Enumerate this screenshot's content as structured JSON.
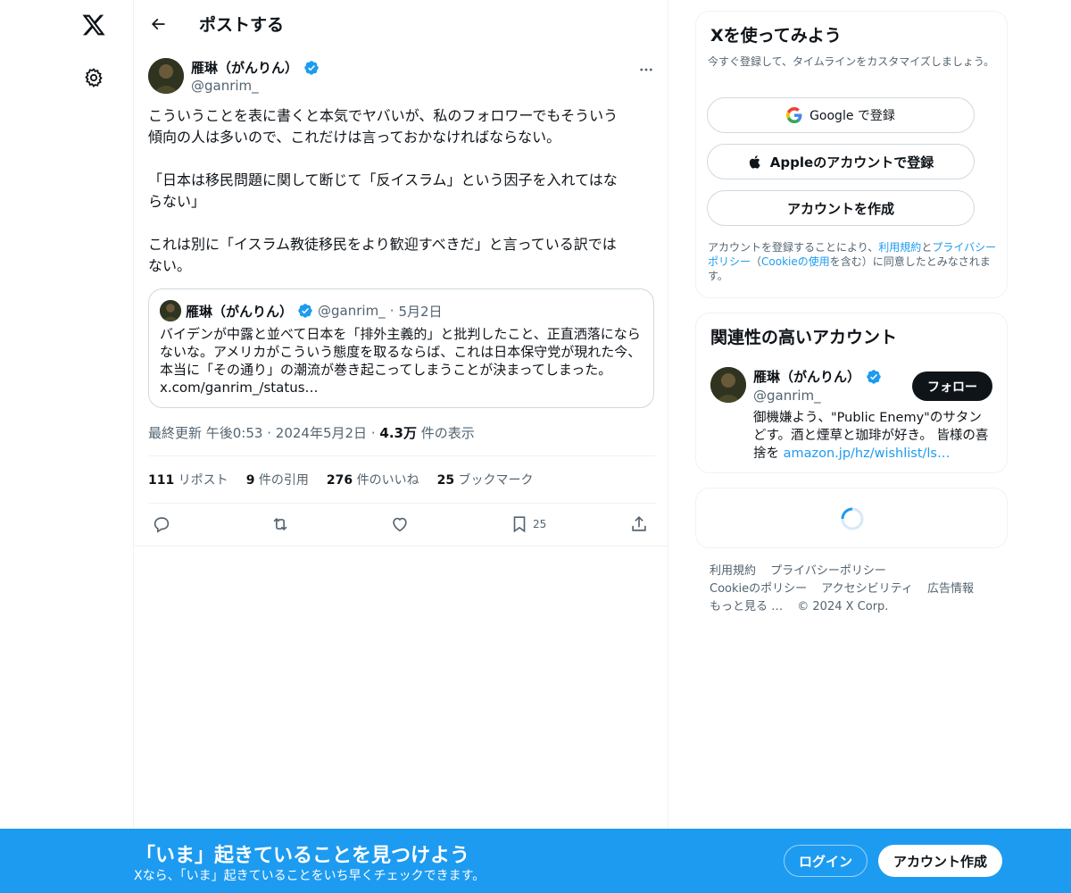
{
  "header": {
    "title": "ポストする"
  },
  "post": {
    "author_name": "雁琳（がんりん）",
    "author_handle": "@ganrim_",
    "text": "こういうことを表に書くと本気でヤバいが、私のフォロワーでもそういう\n傾向の人は多いので、これだけは言っておかなければならない。\n\n「日本は移民問題に関して断じて「反イスラム」という因子を入れてはな\nらない」\n\nこれは別に「イスラム教徒移民をより歓迎すべきだ」と言っている訳では\nない。",
    "quote": {
      "author_name": "雁琳（がんりん）",
      "author_handle": "@ganrim_",
      "date": "5月2日",
      "separator": "·",
      "text": "バイデンが中露と並べて日本を「排外主義的」と批判したこと、正直洒落になら\nないな。アメリカがこういう態度を取るならば、これは日本保守党が現れた今、\n本当に「その通り」の潮流が巻き起こってしまうことが決まってしまった。\nx.com/ganrim_/status…"
    },
    "meta": {
      "updated": "最終更新 午後0:53",
      "date": "2024年5月2日",
      "separator": "·",
      "views_count": "4.3万",
      "views_label": "件の表示"
    },
    "stats": {
      "reposts_count": "111",
      "reposts_label": "リポスト",
      "quotes_count": "9",
      "quotes_label": "件の引用",
      "likes_count": "276",
      "likes_label": "件のいいね",
      "bookmarks_count": "25",
      "bookmarks_label": "ブックマーク"
    },
    "actions": {
      "bookmark_count": "25"
    }
  },
  "signup_card": {
    "title": "Xを使ってみよう",
    "subtitle": "今すぐ登録して、タイムラインをカスタマイズしましょう。",
    "google_label": "Google で登録",
    "apple_label": "Appleのアカウントで登録",
    "create_label": "アカウントを作成",
    "legal_prefix": "アカウントを登録することにより、",
    "legal_terms": "利用規約",
    "legal_and": "と",
    "legal_privacy": "プライバシーポリシー",
    "legal_mid": "（",
    "legal_cookie": "Cookieの使用",
    "legal_suffix": "を含む）に同意したとみなされます。"
  },
  "related": {
    "title": "関連性の高いアカウント",
    "name": "雁琳（がんりん）",
    "handle": "@ganrim_",
    "follow_label": "フォロー",
    "bio_text": "御機嫌よう、\"Public Enemy\"のサタンどす。酒と煙草と珈琲が好き。 皆様の喜捨を ",
    "bio_link": "amazon.jp/hz/wishlist/ls…"
  },
  "footer": {
    "links": [
      "利用規約",
      "プライバシーポリシー",
      "Cookieのポリシー",
      "アクセシビリティ",
      "広告情報",
      "もっと見る …"
    ],
    "copyright": "© 2024 X Corp."
  },
  "banner": {
    "title": "「いま」起きていることを見つけよう",
    "subtitle": "Xなら、「いま」起きていることをいち早くチェックできます。",
    "login_label": "ログイン",
    "signup_label": "アカウント作成"
  },
  "colors": {
    "accent": "#1d9bf0",
    "text": "#0f1419",
    "muted": "#536471",
    "border": "#eff3f4"
  },
  "icons": [
    "x-logo-icon",
    "gear-icon",
    "back-arrow-icon",
    "verified-badge-icon",
    "more-icon",
    "reply-icon",
    "repost-icon",
    "like-icon",
    "bookmark-icon",
    "share-icon",
    "google-icon",
    "apple-icon",
    "loading-spinner-icon"
  ]
}
